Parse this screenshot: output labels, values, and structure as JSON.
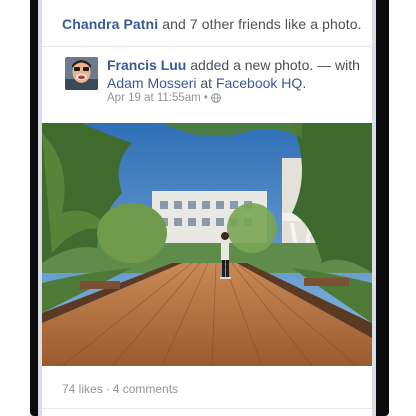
{
  "story": {
    "actor": "Chandra Patni",
    "rest": " and 7 other friends like a photo."
  },
  "post": {
    "author": "Francis Luu",
    "action": " added a new photo. — with ",
    "tagged": "Adam Mosseri",
    "at": " at ",
    "place": "Facebook HQ",
    "period": ".",
    "timestamp": "Apr 19 at 11:55am",
    "privacy_icon": "globe-icon"
  },
  "footer": {
    "likes": "74 likes",
    "separator": "·",
    "comments": "4 comments"
  },
  "colors": {
    "link": "#3b5998",
    "meta": "#90949c",
    "text": "#4b4f56"
  }
}
